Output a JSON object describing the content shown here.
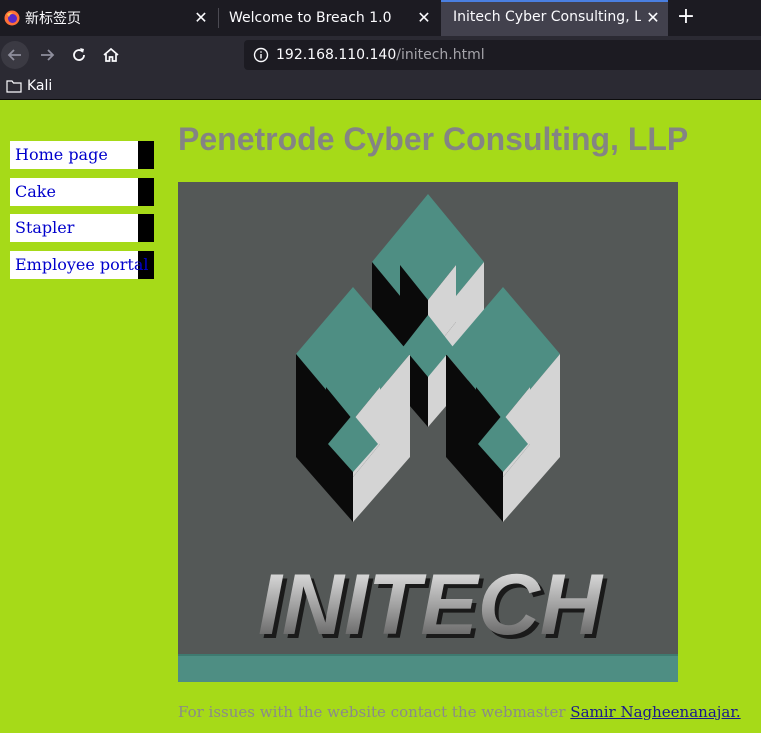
{
  "browser": {
    "tabs": [
      {
        "label": "新标签页",
        "active": false
      },
      {
        "label": "Welcome to Breach 1.0",
        "active": false
      },
      {
        "label": "Initech Cyber Consulting, LLC",
        "active": true
      }
    ],
    "url": {
      "host": "192.168.110.140",
      "path": "/initech.html"
    },
    "bookmarks": [
      {
        "label": "Kali",
        "icon": "folder-icon"
      }
    ],
    "colors": {
      "accent": "#4a7fe0",
      "chrome": "#2b2a33",
      "tabbar": "#1c1b22"
    }
  },
  "page": {
    "title": "Penetrode Cyber Consulting, LLP",
    "sidebar": [
      {
        "label": "Home page"
      },
      {
        "label": "Cake"
      },
      {
        "label": "Stapler"
      },
      {
        "label": "Employee portal"
      }
    ],
    "logo": {
      "wordmark": "INITECH"
    },
    "footer": {
      "text": "For issues with the website contact the webmaster ",
      "link_label": "Samir Nagheenanajar."
    },
    "colors": {
      "background": "#a6da18",
      "title": "#848484",
      "link": "#0000cc",
      "logo_teal": "#4e8e83"
    }
  }
}
